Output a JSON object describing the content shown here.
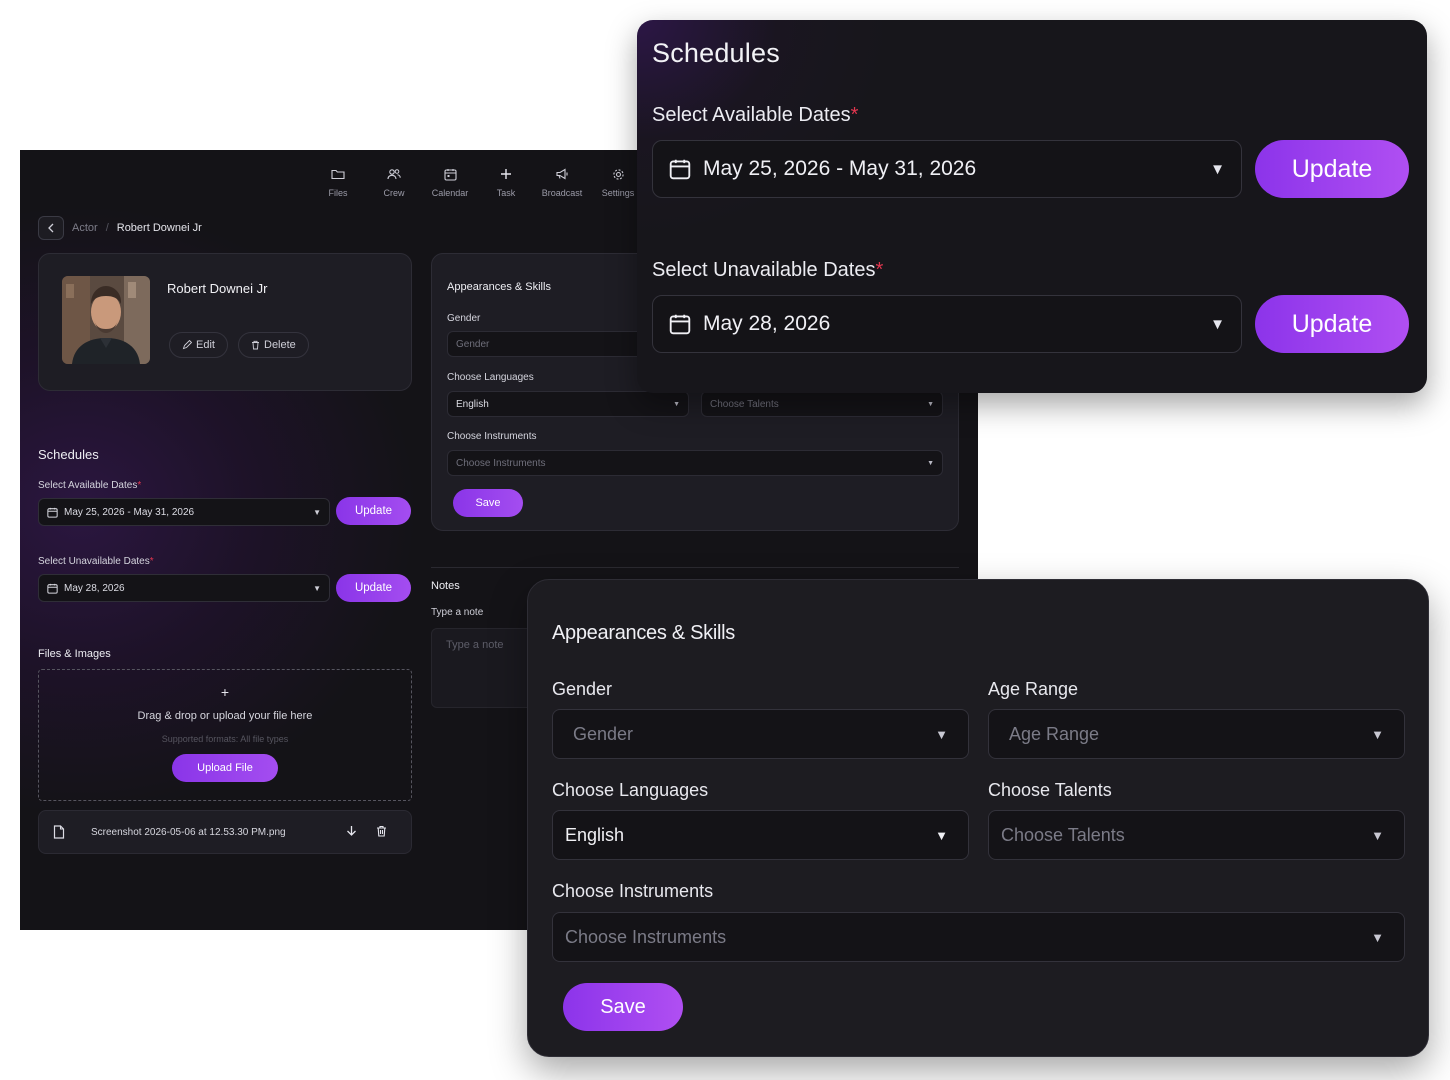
{
  "nav": [
    {
      "label": "Files",
      "icon": "folder-icon"
    },
    {
      "label": "Crew",
      "icon": "people-icon"
    },
    {
      "label": "Calendar",
      "icon": "calendar-icon"
    },
    {
      "label": "Task",
      "icon": "plus-icon"
    },
    {
      "label": "Broadcast",
      "icon": "megaphone-icon"
    },
    {
      "label": "Settings",
      "icon": "gear-icon"
    }
  ],
  "breadcrumb": {
    "parent": "Actor",
    "separator": "/",
    "current": "Robert Downei Jr"
  },
  "profile": {
    "name": "Robert Downei Jr",
    "edit_label": "Edit",
    "delete_label": "Delete"
  },
  "schedules": {
    "title": "Schedules",
    "available_label": "Select Available Dates",
    "available_value": "May 25, 2026 - May 31, 2026",
    "unavailable_label": "Select Unavailable Dates",
    "unavailable_value": "May 28, 2026",
    "update_label": "Update",
    "required_mark": "*"
  },
  "files": {
    "title": "Files & Images",
    "plus": "+",
    "drop_text": "Drag & drop or upload your file here",
    "supported": "Supported formats: All file types",
    "upload_label": "Upload File",
    "file_name": "Screenshot 2026-05-06 at 12.53.30 PM.png"
  },
  "appearance": {
    "title": "Appearances & Skills",
    "gender_label": "Gender",
    "gender_placeholder": "Gender",
    "age_label": "Age Range",
    "age_placeholder": "Age Range",
    "languages_label": "Choose Languages",
    "languages_value": "English",
    "talents_label": "Choose Talents",
    "talents_placeholder": "Choose Talents",
    "instruments_label": "Choose Instruments",
    "instruments_placeholder": "Choose Instruments",
    "save_label": "Save"
  },
  "notes": {
    "title": "Notes",
    "label": "Type a note",
    "placeholder": "Type a note"
  },
  "colors": {
    "accent": "#9b44ee",
    "background": "#141317",
    "card": "#1e1d24",
    "required": "#e3364f"
  }
}
